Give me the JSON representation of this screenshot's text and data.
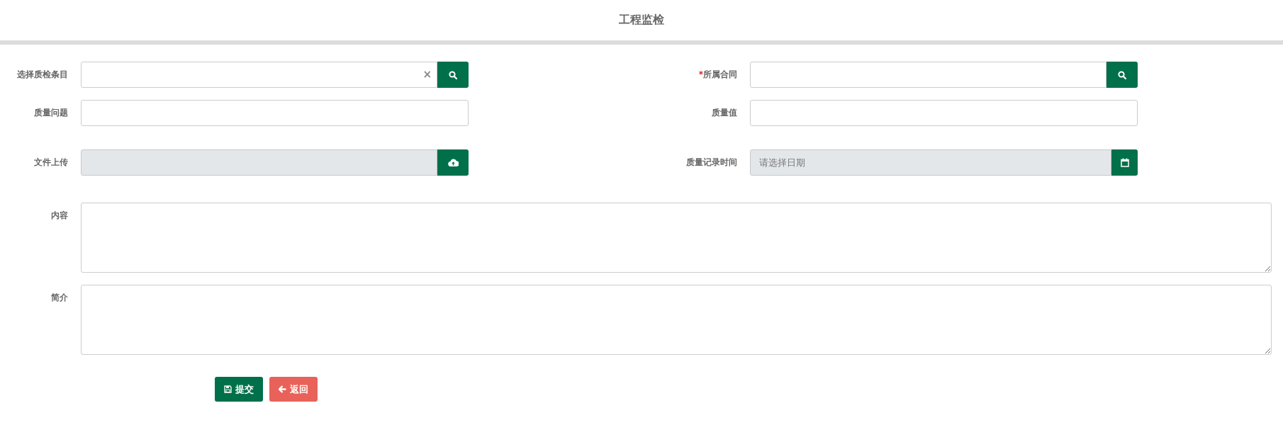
{
  "title": "工程监检",
  "fields": [
    {
      "kind": "search",
      "label": "选择质检条目",
      "required": false,
      "clearable": true,
      "disabled": false
    },
    {
      "kind": "search",
      "label": "所属合同",
      "required": true,
      "disabled": false
    },
    {
      "kind": "text",
      "label": "质量问题",
      "required": false,
      "disabled": false
    },
    {
      "kind": "text",
      "label": "质量值",
      "required": false,
      "disabled": false
    },
    {
      "kind": "upload",
      "label": "文件上传",
      "disabled": true
    },
    {
      "kind": "date",
      "label": "质量记录时间",
      "disabled": true,
      "placeholder": "请选择日期"
    }
  ],
  "textareas": [
    {
      "label": "内容"
    },
    {
      "label": "简介"
    }
  ],
  "required_mark": "*",
  "clear_glyph": "×",
  "buttons": [
    {
      "kind": "submit",
      "label": "提交"
    },
    {
      "kind": "back",
      "label": "返回"
    }
  ]
}
